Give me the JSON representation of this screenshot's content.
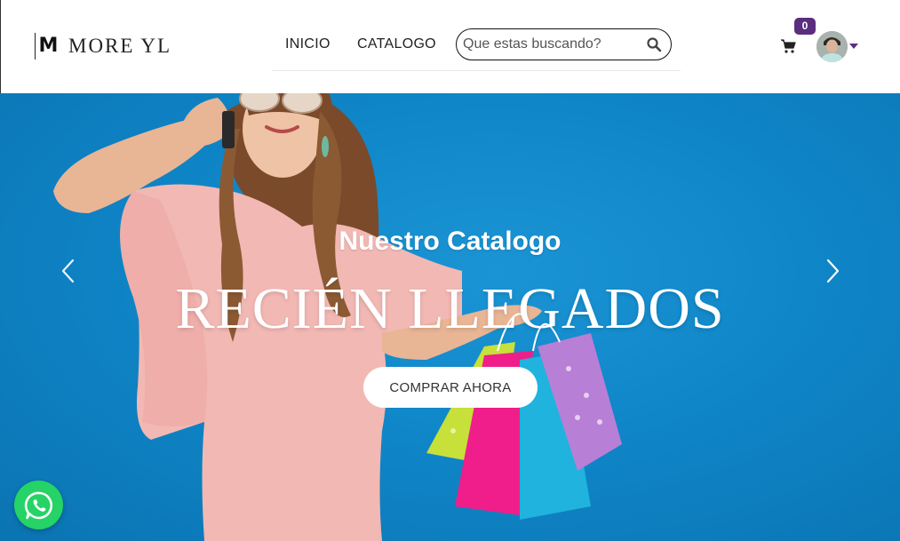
{
  "brand": {
    "logo_mark": "M",
    "name": "MORE YL"
  },
  "nav": {
    "items": [
      {
        "label": "INICIO"
      },
      {
        "label": "CATALOGO"
      }
    ]
  },
  "search": {
    "placeholder": "Que estas buscando?",
    "value": ""
  },
  "cart": {
    "count": "0",
    "icon": "shopping-cart-icon"
  },
  "user": {
    "avatar_icon": "user-avatar",
    "menu_icon": "caret-down-icon"
  },
  "hero": {
    "subtitle": "Nuestro Catalogo",
    "title": "RECIÉN LLEGADOS",
    "cta_label": "COMPRAR AHORA",
    "prev_icon": "chevron-left-icon",
    "next_icon": "chevron-right-icon"
  },
  "whatsapp": {
    "icon": "whatsapp-icon"
  },
  "colors": {
    "accent": "#5b2d7e",
    "hero_bg": "#0f86c8",
    "whatsapp": "#25d366"
  }
}
